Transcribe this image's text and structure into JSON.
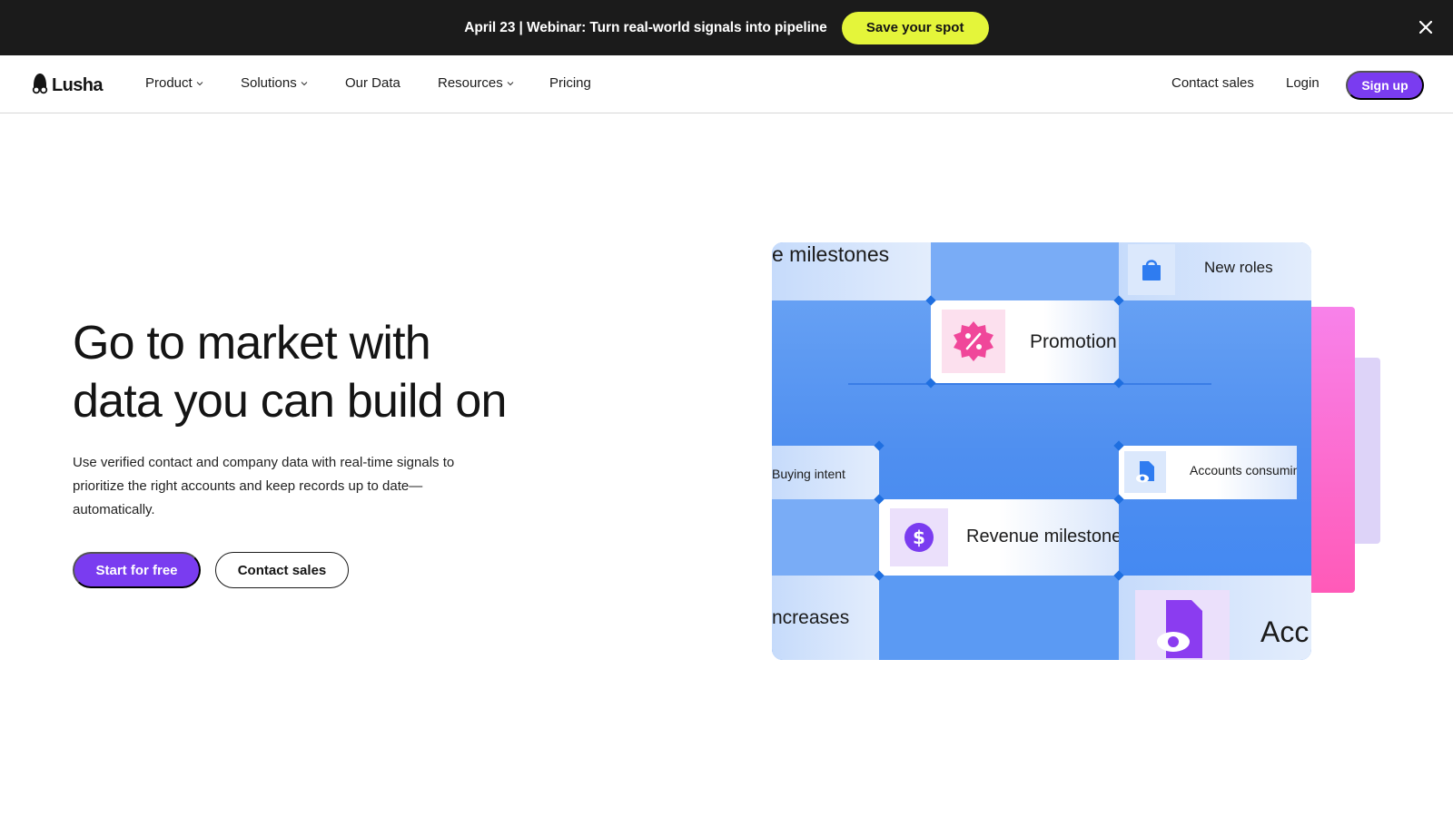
{
  "announcement": {
    "text": "April 23 | Webinar: Turn real-world signals into pipeline",
    "cta_label": "Save your spot",
    "cta_color": "#e4f53a",
    "close_icon": "close-icon"
  },
  "nav": {
    "logo_text": "Lusha",
    "items": [
      {
        "label": "Product",
        "has_dropdown": true
      },
      {
        "label": "Solutions",
        "has_dropdown": true
      },
      {
        "label": "Our Data",
        "has_dropdown": false
      },
      {
        "label": "Resources",
        "has_dropdown": true
      },
      {
        "label": "Pricing",
        "has_dropdown": false
      }
    ],
    "contact_sales": "Contact sales",
    "login": "Login",
    "signup": "Sign up",
    "accent_color": "#7a3cf0"
  },
  "hero": {
    "title_line1": "Go to market with",
    "title_line2": "data you can build on",
    "subtitle": "Use verified contact and company data with real-time signals to prioritize the right accounts and keep records up to date—automatically.",
    "primary_cta": "Start for free",
    "secondary_cta": "Contact sales"
  },
  "illustration": {
    "cards": {
      "milestones": "e milestones",
      "new_roles": "New roles",
      "promotion": "Promotion",
      "buying_intent": "Buying intent",
      "accounts_consuming": "Accounts consuming",
      "revenue_milestones": "Revenue milestones",
      "increases": "ncreases",
      "acc": "Acc"
    },
    "icons": [
      "bag-icon",
      "discount-badge-icon",
      "document-eye-icon",
      "dollar-icon",
      "document-eye-icon"
    ]
  }
}
